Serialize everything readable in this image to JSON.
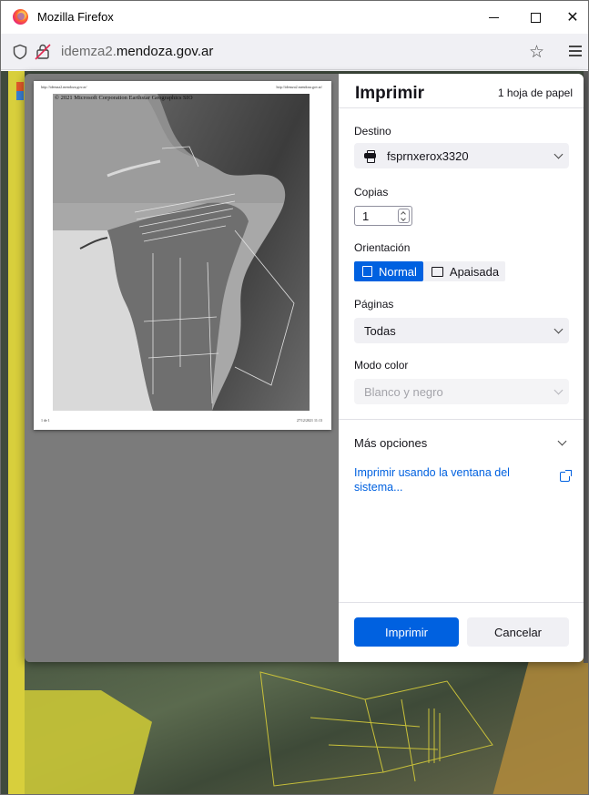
{
  "window": {
    "title": "Mozilla Firefox",
    "url_prefix": "idemza2.",
    "url_domain": "mendoza.gov.ar"
  },
  "preview": {
    "header_left": "http://idemza2.mendoza.gov.ar/",
    "header_right": "http://idemza2.mendoza.gov.ar/",
    "copyright": "© 2021 Microsoft Corporation Earthstar Geographics SIO",
    "footer_left": "1 de 1",
    "footer_right": "27/12/2021 11:13"
  },
  "print": {
    "title": "Imprimir",
    "sheets": "1 hoja de papel",
    "destination_label": "Destino",
    "destination_value": "fsprnxerox3320",
    "copies_label": "Copias",
    "copies_value": "1",
    "orientation_label": "Orientación",
    "orientation_portrait": "Normal",
    "orientation_landscape": "Apaisada",
    "pages_label": "Páginas",
    "pages_value": "Todas",
    "color_label": "Modo color",
    "color_value": "Blanco y negro",
    "more_options": "Más opciones",
    "system_dialog_link": "Imprimir usando la ventana del sistema...",
    "print_button": "Imprimir",
    "cancel_button": "Cancelar"
  },
  "colors": {
    "accent": "#0061e0",
    "map_yellow": "#d8cf3c"
  }
}
